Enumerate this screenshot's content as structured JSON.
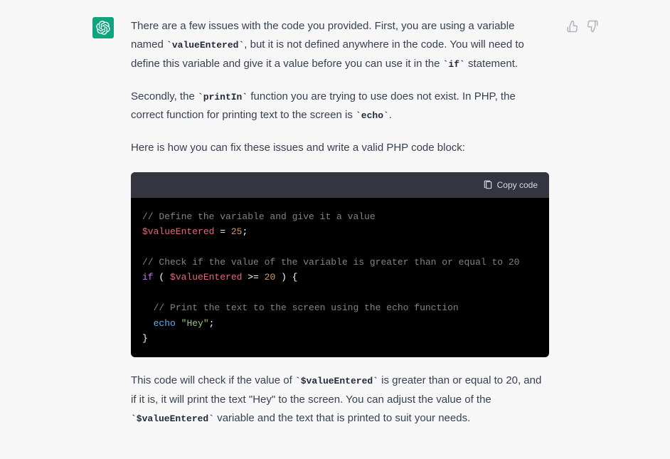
{
  "message": {
    "paragraph1_parts": [
      {
        "text": "There are a few issues with the code you provided. First, you are using a variable named ",
        "type": "text"
      },
      {
        "text": "`valueEntered`",
        "type": "code"
      },
      {
        "text": ", but it is not defined anywhere in the code. You will need to define this variable and give it a value before you can use it in the ",
        "type": "text"
      },
      {
        "text": "`if`",
        "type": "code"
      },
      {
        "text": " statement.",
        "type": "text"
      }
    ],
    "paragraph2_parts": [
      {
        "text": "Secondly, the ",
        "type": "text"
      },
      {
        "text": "`printIn`",
        "type": "code"
      },
      {
        "text": " function you are trying to use does not exist. In PHP, the correct function for printing text to the screen is ",
        "type": "text"
      },
      {
        "text": "`echo`",
        "type": "code"
      },
      {
        "text": ".",
        "type": "text"
      }
    ],
    "paragraph3": "Here is how you can fix these issues and write a valid PHP code block:",
    "paragraph4_parts": [
      {
        "text": "This code will check if the value of ",
        "type": "text"
      },
      {
        "text": "`$valueEntered`",
        "type": "code"
      },
      {
        "text": " is greater than or equal to 20, and if it is, it will print the text \"Hey\" to the screen. You can adjust the value of the ",
        "type": "text"
      },
      {
        "text": "`$valueEntered`",
        "type": "code"
      },
      {
        "text": " variable and the text that is printed to suit your needs.",
        "type": "text"
      }
    ]
  },
  "code": {
    "copy_label": "Copy code",
    "lines": [
      [
        {
          "t": "// Define the variable and give it a value",
          "c": "comment"
        }
      ],
      [
        {
          "t": "$valueEntered",
          "c": "variable"
        },
        {
          "t": " = ",
          "c": "operator"
        },
        {
          "t": "25",
          "c": "number"
        },
        {
          "t": ";",
          "c": "punct"
        }
      ],
      [],
      [
        {
          "t": "// Check if the value of the variable is greater than or equal to 20",
          "c": "comment"
        }
      ],
      [
        {
          "t": "if",
          "c": "keyword"
        },
        {
          "t": " ( ",
          "c": "punct"
        },
        {
          "t": "$valueEntered",
          "c": "variable"
        },
        {
          "t": " >= ",
          "c": "operator"
        },
        {
          "t": "20",
          "c": "number"
        },
        {
          "t": " ) {",
          "c": "punct"
        }
      ],
      [],
      [
        {
          "t": "  ",
          "c": "punct"
        },
        {
          "t": "// Print the text to the screen using the echo function",
          "c": "comment"
        }
      ],
      [
        {
          "t": "  ",
          "c": "punct"
        },
        {
          "t": "echo",
          "c": "func"
        },
        {
          "t": " ",
          "c": "punct"
        },
        {
          "t": "\"Hey\"",
          "c": "string"
        },
        {
          "t": ";",
          "c": "punct"
        }
      ],
      [
        {
          "t": "}",
          "c": "punct"
        }
      ]
    ]
  }
}
